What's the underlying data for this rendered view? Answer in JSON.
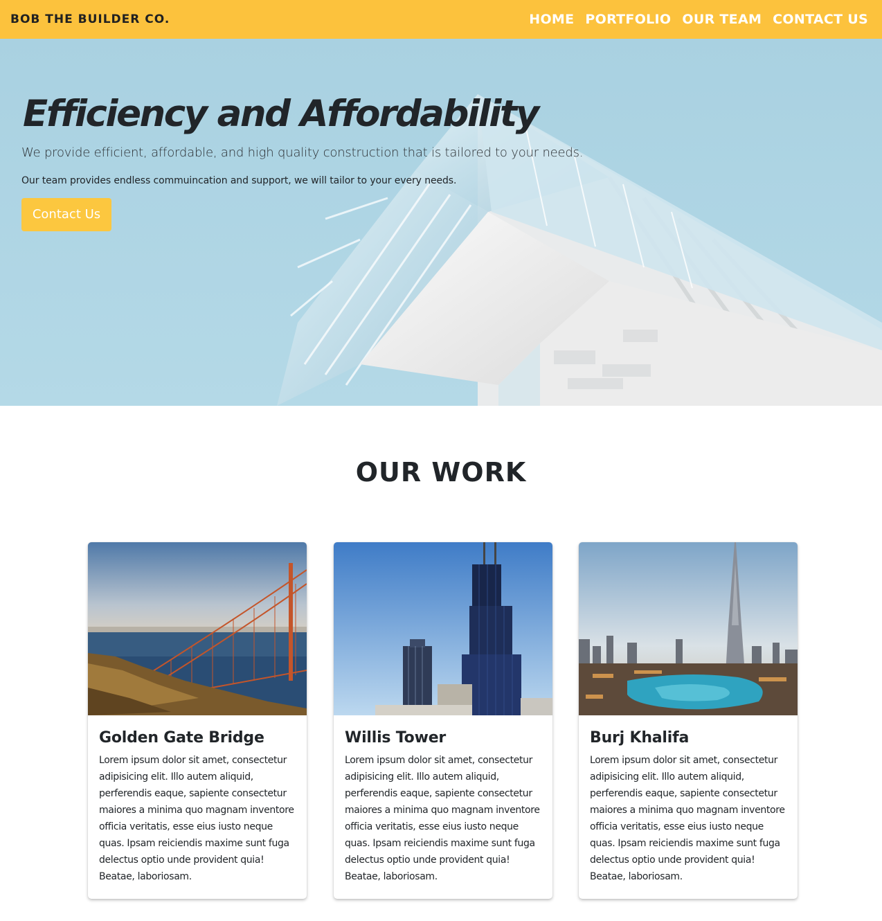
{
  "navbar": {
    "brand": "BOB THE BUILDER CO.",
    "links": [
      "HOME",
      "PORTFOLIO",
      "OUR TEAM",
      "CONTACT US"
    ],
    "background": "#fcc23d"
  },
  "hero": {
    "title": "Efficiency and Affordability",
    "lead": "We provide efficient, affordable, and high quality construction that is tailored to your needs.",
    "subtext": "Our team provides endless commuincation and support, we will tailor to your every needs.",
    "button_label": "Contact Us",
    "background": "#b0d6e5"
  },
  "work": {
    "title": "OUR WORK",
    "cards": [
      {
        "title": "Golden Gate Bridge",
        "text": "Lorem ipsum dolor sit amet, consectetur adipisicing elit. Illo autem aliquid, perferendis eaque, sapiente consectetur maiores a minima quo magnam inventore officia veritatis, esse eius iusto neque quas. Ipsam reiciendis maxime sunt fuga delectus optio unde provident quia! Beatae, laboriosam."
      },
      {
        "title": "Willis Tower",
        "text": "Lorem ipsum dolor sit amet, consectetur adipisicing elit. Illo autem aliquid, perferendis eaque, sapiente consectetur maiores a minima quo magnam inventore officia veritatis, esse eius iusto neque quas. Ipsam reiciendis maxime sunt fuga delectus optio unde provident quia! Beatae, laboriosam."
      },
      {
        "title": "Burj Khalifa",
        "text": "Lorem ipsum dolor sit amet, consectetur adipisicing elit. Illo autem aliquid, perferendis eaque, sapiente consectetur maiores a minima quo magnam inventore officia veritatis, esse eius iusto neque quas. Ipsam reiciendis maxime sunt fuga delectus optio unde provident quia! Beatae, laboriosam."
      }
    ]
  }
}
